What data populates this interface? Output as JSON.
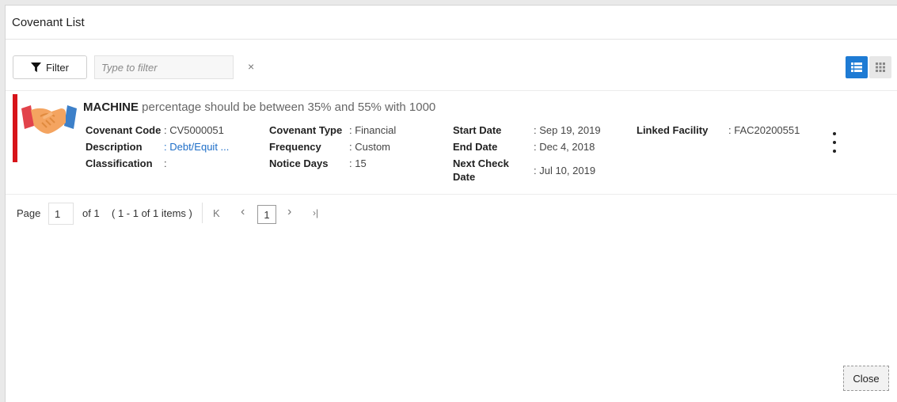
{
  "dialog": {
    "title": "Covenant List"
  },
  "toolbar": {
    "filter_label": "Filter",
    "filter_placeholder": "Type to filter",
    "clear_symbol": "×"
  },
  "card": {
    "title_bold": "MACHINE",
    "title_rest": " percentage should be between 35% and 55% with 1000",
    "fields": {
      "covenant_code_label": "Covenant Code",
      "covenant_code_value": ": CV5000051",
      "description_label": "Description",
      "description_value": ": Debt/Equit ...",
      "classification_label": "Classification",
      "classification_value": ":",
      "covenant_type_label": "Covenant Type",
      "covenant_type_value": ": Financial",
      "frequency_label": "Frequency",
      "frequency_value": ": Custom",
      "notice_days_label": "Notice Days",
      "notice_days_value": ": 15",
      "start_date_label": "Start Date",
      "start_date_value": ": Sep 19, 2019",
      "end_date_label": "End Date",
      "end_date_value": ": Dec 4, 2018",
      "next_check_label_line1": "Next Check",
      "next_check_label_line2": "Date",
      "next_check_value": ": Jul 10, 2019",
      "linked_facility_label": "Linked Facility",
      "linked_facility_value": ": FAC20200551"
    }
  },
  "pager": {
    "page_label": "Page",
    "page_value": "1",
    "of_text": "of 1",
    "items_text": "( 1 - 1 of 1 items )",
    "first": "K",
    "prev": "‹",
    "current": "1",
    "next": "›",
    "last": "›|"
  },
  "footer": {
    "close_label": "Close"
  },
  "colors": {
    "accent_red": "#d7141a",
    "primary_blue": "#1e7bd4",
    "link_blue": "#1e6ec8"
  },
  "icons": {
    "filter": "funnel-icon",
    "list_view": "list-view-icon",
    "grid_view": "grid-view-icon",
    "logo": "handshake-icon",
    "kebab": "more-vertical-icon"
  }
}
